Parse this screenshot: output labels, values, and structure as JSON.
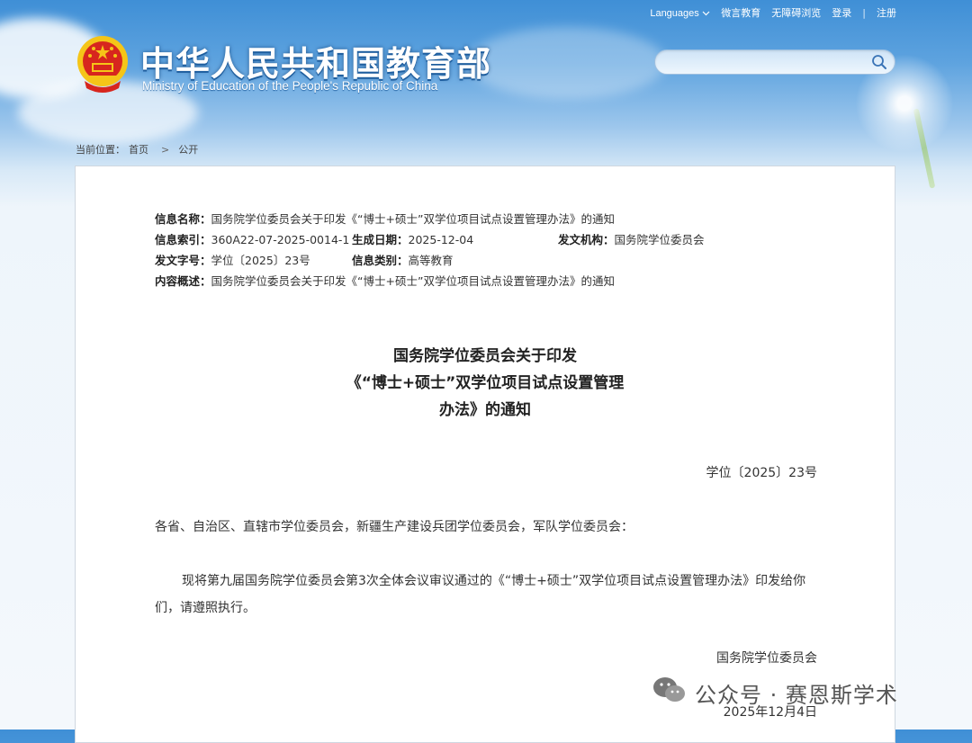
{
  "header": {
    "logo_cn": "中华人民共和国教育部",
    "logo_en": "Ministry of Education of the People's Republic of China",
    "nav": {
      "languages": "Languages",
      "weiyan": "微言教育",
      "accessible": "无障碍浏览",
      "login": "登录",
      "separator": "|",
      "register": "注册"
    },
    "search_placeholder": ""
  },
  "breadcrumb": {
    "label": "当前位置：",
    "home": "首页",
    "chevron": ">",
    "current": "公开"
  },
  "meta": {
    "name_label": "信息名称：",
    "name_value": "国务院学位委员会关于印发《“博士+硕士”双学位项目试点设置管理办法》的通知",
    "index_label": "信息索引：",
    "index_value": "360A22-07-2025-0014-1",
    "date_label": "生成日期：",
    "date_value": "2025-12-04",
    "org_label": "发文机构：",
    "org_value": "国务院学位委员会",
    "docno_label": "发文字号：",
    "docno_value": "学位〔2025〕23号",
    "category_label": "信息类别：",
    "category_value": "高等教育",
    "summary_label": "内容概述：",
    "summary_value": "国务院学位委员会关于印发《“博士+硕士”双学位项目试点设置管理办法》的通知"
  },
  "document": {
    "title_line1": "国务院学位委员会关于印发",
    "title_line2": "《“博士+硕士”双学位项目试点设置管理",
    "title_line3": "办法》的通知",
    "doc_number": "学位〔2025〕23号",
    "addressee": "各省、自治区、直辖市学位委员会，新疆生产建设兵团学位委员会，军队学位委员会：",
    "body": "现将第九届国务院学位委员会第3次全体会议审议通过的《“博士+硕士”双学位项目试点设置管理办法》印发给你们，请遵照执行。",
    "signer": "国务院学位委员会",
    "sign_date": "2025年12月4日"
  },
  "watermark": {
    "text": "公众号 · 赛恩斯学术"
  },
  "colors": {
    "sky_top": "#3f8fd6",
    "emblem_red": "#d7261e",
    "emblem_gold": "#f5c518"
  },
  "icons": {
    "search": "search-icon",
    "chevron": "chevron-down-icon",
    "emblem": "national-emblem-icon",
    "wechat": "wechat-icon"
  }
}
